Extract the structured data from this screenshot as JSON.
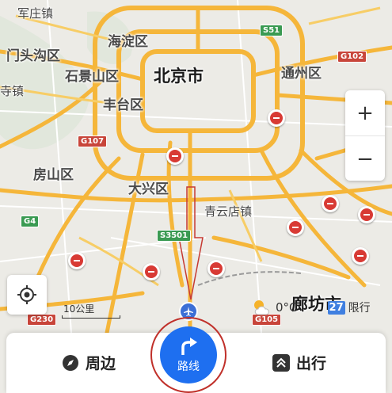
{
  "labels": {
    "city": "北京市",
    "districts": [
      "海淀区",
      "门头沟区",
      "石景山区",
      "丰台区",
      "通州区",
      "房山区",
      "大兴区",
      "廊坊市"
    ],
    "towns": [
      "军庄镇",
      "青云店镇"
    ],
    "partial": "寺镇"
  },
  "shields": [
    "S51",
    "G102",
    "G107",
    "G4",
    "S3501",
    "G105",
    "G230"
  ],
  "scale": {
    "text": "10公里"
  },
  "weather": {
    "temp": "0°C",
    "aq": "27",
    "restrict": "限行"
  },
  "controls": {
    "zoom_in": "+",
    "zoom_out": "−"
  },
  "bottom": {
    "nearby": "周边",
    "route": "路线",
    "travel": "出行"
  },
  "colors": {
    "road": "#f5b63a",
    "road_edge": "#e39a22",
    "accent": "#1e6ff0",
    "marker": "#d83a34"
  }
}
